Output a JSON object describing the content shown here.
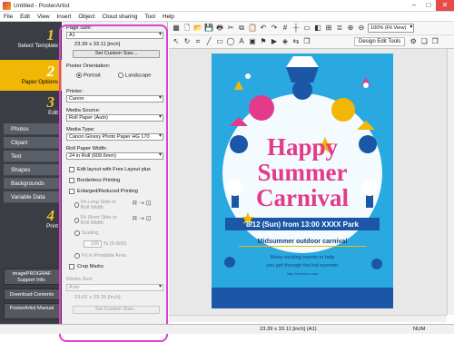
{
  "window": {
    "title": "Untitled - PosterArtist",
    "buttons": [
      "–",
      "□",
      "✕"
    ]
  },
  "menu": [
    "File",
    "Edit",
    "View",
    "Insert",
    "Object",
    "Cloud sharing",
    "Tool",
    "Help"
  ],
  "nav": {
    "steps": [
      {
        "num": "1",
        "label": "Select Template"
      },
      {
        "num": "2",
        "label": "Paper Options"
      },
      {
        "num": "3",
        "label": "Edit"
      },
      {
        "num": "4",
        "label": "Print"
      }
    ],
    "edit_items": [
      "Photos",
      "Clipart",
      "Text",
      "Shapes",
      "Backgrounds",
      "Variable Data"
    ],
    "bottom_buttons": [
      "imagePROGRAF Support Info.",
      "Download Contents",
      "PosterArtist Manual"
    ]
  },
  "panel": {
    "page_size_label": "Page Size:",
    "page_size_value": "A1",
    "page_size_dims": "23.39 x 33.11 [inch]",
    "set_custom_size": "Set Custom Size...",
    "orientation_label": "Poster Orientation:",
    "portrait": "Portrait",
    "landscape": "Landscape",
    "printer_label": "Printer:",
    "printer_value": "Canon",
    "media_source_label": "Media Source:",
    "media_source_value": "Roll Paper (Auto)",
    "media_type_label": "Media Type:",
    "media_type_value": "Canon Glossy Photo Paper HG 170",
    "roll_width_label": "Roll Paper Width:",
    "roll_width_value": "24 in Roll (609.6mm)",
    "edit_layout": "Edit layout with Free Layout plus",
    "borderless": "Borderless Printing",
    "enlarged": "Enlarged/Reduced Printing",
    "fit_long": "Fit Long Side to Roll Width",
    "fit_short": "Fit Short Side to Roll Width",
    "scaling": "Scaling",
    "scaling_value": "100",
    "scaling_range": "% (5-600)",
    "fit_printable": "Fit in Printable Area",
    "crop_marks": "Crop Marks",
    "media_size_label": "Media Size",
    "media_size_value": "Auto",
    "media_size_dims": "23.62 x 33.35 [inch]",
    "set_custom_size2": "Set Custom Size..."
  },
  "toolbar": {
    "zoom_value": "100% (Fit View)",
    "design_edit_tools": "Design Edit Tools"
  },
  "poster": {
    "line1": "Happy",
    "line2": "Summer",
    "line3": "Carnival",
    "date_banner": "8/12 (Sun) from 13:00  XXXX Park",
    "subtitle": "Midsummer outdoor carnival",
    "desc1": "Many exciting events to help",
    "desc2": "you get through the hot summer",
    "url": "http://xxxxxxxx.com"
  },
  "status": {
    "dims": "23.39 x 33.11 [inch] (A1)",
    "num": "NUM"
  },
  "colors": {
    "poster_bg": "#2aa8e0",
    "highlight": "#e23cd1",
    "accent": "#f2b705",
    "pink": "#e33a8c"
  }
}
